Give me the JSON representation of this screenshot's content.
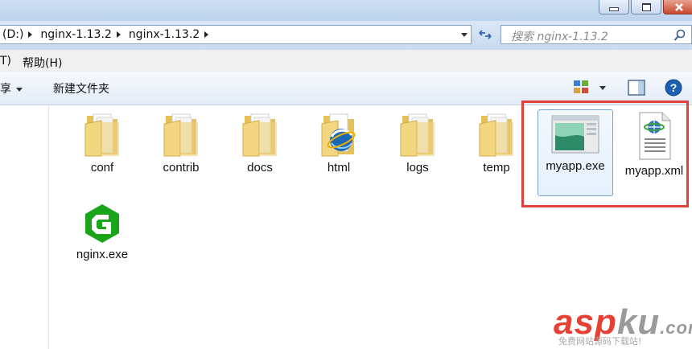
{
  "address": {
    "crumbs": [
      "(D:)",
      "nginx-1.13.2",
      "nginx-1.13.2"
    ]
  },
  "search": {
    "placeholder": "搜索 nginx-1.13.2"
  },
  "menu": {
    "items": [
      "T)",
      "帮助(H)"
    ]
  },
  "toolbar": {
    "share_label": "享",
    "new_folder_label": "新建文件夹"
  },
  "files": [
    {
      "name": "conf",
      "type": "folder"
    },
    {
      "name": "contrib",
      "type": "folder"
    },
    {
      "name": "docs",
      "type": "folder"
    },
    {
      "name": "html",
      "type": "folder-ie"
    },
    {
      "name": "logs",
      "type": "folder"
    },
    {
      "name": "temp",
      "type": "folder"
    },
    {
      "name": "myapp.exe",
      "type": "exe",
      "selected": true
    },
    {
      "name": "myapp.xml",
      "type": "xml-doc"
    },
    {
      "name": "nginx.exe",
      "type": "nginx-exe"
    }
  ],
  "watermark": {
    "text_red": "asp",
    "text_gray": "ku",
    "text_com": ".com",
    "sub": "免费网站源码下载站!"
  },
  "colors": {
    "highlight_box": "#e2403a",
    "watermark_red": "#e64133",
    "nginx_green": "#1aa41a"
  }
}
